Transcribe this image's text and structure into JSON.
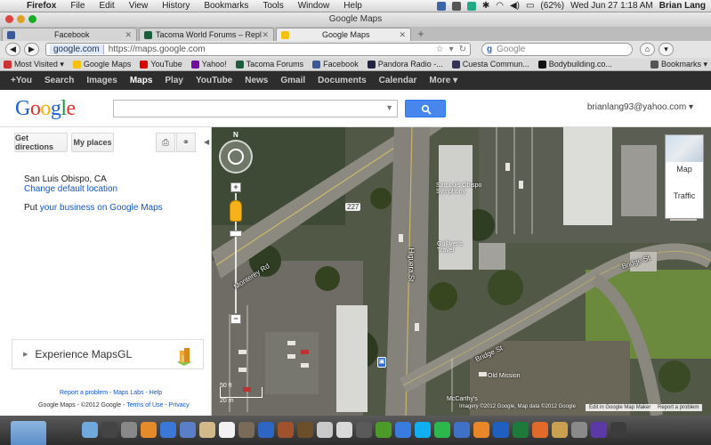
{
  "os_menubar": {
    "app": "Firefox",
    "menus": [
      "File",
      "Edit",
      "View",
      "History",
      "Bookmarks",
      "Tools",
      "Window",
      "Help"
    ],
    "battery": "(62%)",
    "datetime": "Wed Jun 27  1:18 AM",
    "user": "Brian Lang"
  },
  "window": {
    "title": "Google Maps"
  },
  "tabs": [
    {
      "label": "Facebook",
      "color": "#3b5998",
      "active": false
    },
    {
      "label": "Tacoma World Forums – Reply t...",
      "color": "#1c5e3c",
      "active": false
    },
    {
      "label": "Google Maps",
      "color": "#f4c20d",
      "active": true
    }
  ],
  "nav": {
    "domain": "google.com",
    "url": "https://maps.google.com",
    "search_placeholder": "Google"
  },
  "bookmarks": [
    {
      "label": "Most Visited ▾",
      "color": "#c33"
    },
    {
      "label": "Google Maps",
      "color": "#f4c20d"
    },
    {
      "label": "YouTube",
      "color": "#d00"
    },
    {
      "label": "Yahoo!",
      "color": "#720e9e"
    },
    {
      "label": "Tacoma Forums",
      "color": "#1c5e3c"
    },
    {
      "label": "Facebook",
      "color": "#3b5998"
    },
    {
      "label": "Pandora Radio -...",
      "color": "#224"
    },
    {
      "label": "Cuesta Commun...",
      "color": "#335"
    },
    {
      "label": "Bodybuilding.co...",
      "color": "#111"
    }
  ],
  "bookmarks_menu": "Bookmarks ▾",
  "google_bar": [
    "+You",
    "Search",
    "Images",
    "Maps",
    "Play",
    "YouTube",
    "News",
    "Gmail",
    "Documents",
    "Calendar",
    "More ▾"
  ],
  "google_bar_active": "Maps",
  "header": {
    "logo": "Google",
    "account": "brianlang93@yahoo.com ▾"
  },
  "sidebar": {
    "get_directions": "Get directions",
    "my_places": "My places",
    "location": "San Luis Obispo, CA",
    "change_location": "Change default location",
    "put_prefix": "Put ",
    "put_link": "your business on Google Maps",
    "mapsgl": "Experience MapsGL",
    "footer_links": "Report a problem - Maps Labs - Help",
    "footer_copy_prefix": "Google Maps - ©2012 Google - ",
    "terms": "Terms of Use",
    "privacy": "Privacy"
  },
  "map": {
    "compass": "N",
    "type_map": "Map",
    "type_traffic": "Traffic",
    "labels": {
      "monterey": "Monterey Rd",
      "higuera": "Higuera St",
      "bridge_top": "Bridge St",
      "bridge_low": "Bridge St",
      "route": "227",
      "symphony": "San Luis Obispo Symphony",
      "gullivers": "Gulliver's Travel",
      "mission": "Old Mission",
      "mccarthys": "McCarthy's"
    },
    "scale_ft": "50 ft",
    "scale_m": "20 m",
    "attribution": "Imagery ©2012 Google, Map data ©2012 Google",
    "edit_btn": "Edit in Google Map Maker",
    "report_btn": "Report a problem"
  }
}
